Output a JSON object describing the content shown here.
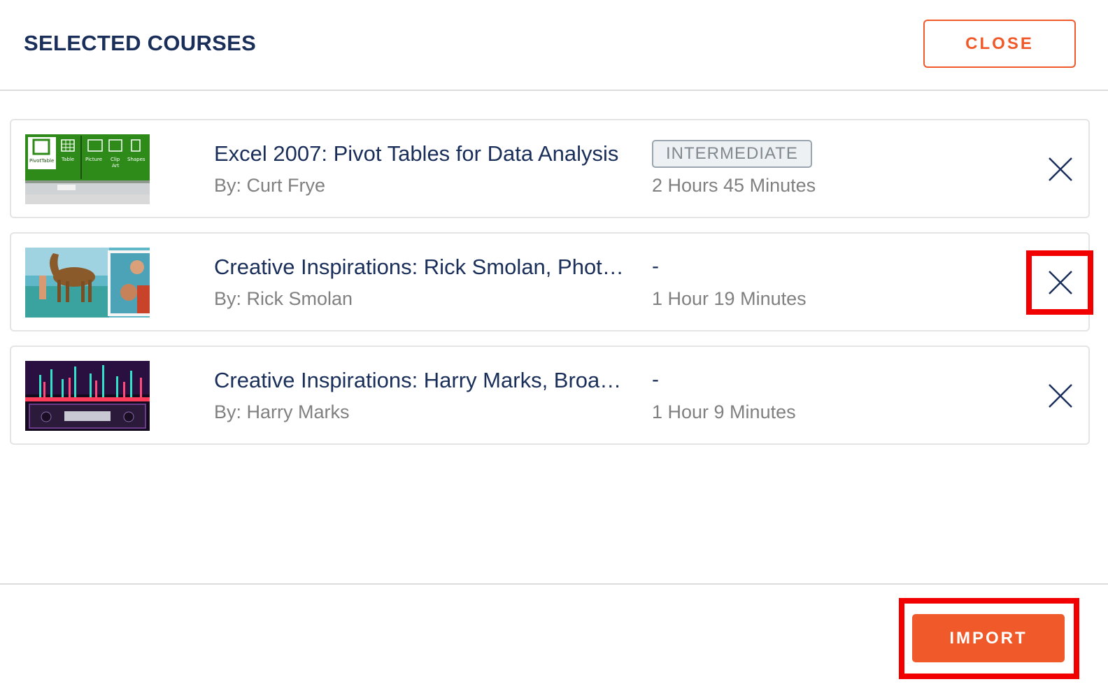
{
  "header": {
    "title": "SELECTED COURSES",
    "close_label": "CLOSE"
  },
  "courses": [
    {
      "title": "Excel 2007: Pivot Tables for Data Analysis",
      "author": "By: Curt Frye",
      "level": "INTERMEDIATE",
      "duration": "2 Hours 45 Minutes"
    },
    {
      "title": "Creative Inspirations: Rick Smolan, Phot…",
      "author": "By: Rick Smolan",
      "level": "-",
      "duration": "1 Hour 19 Minutes"
    },
    {
      "title": "Creative Inspirations: Harry Marks, Broa…",
      "author": "By: Harry Marks",
      "level": "-",
      "duration": "1 Hour 9 Minutes"
    }
  ],
  "footer": {
    "import_label": "IMPORT"
  },
  "colors": {
    "accent": "#f05a2b",
    "title_navy": "#1a2e5a",
    "muted_text": "#808080",
    "highlight_red": "#f20000"
  }
}
